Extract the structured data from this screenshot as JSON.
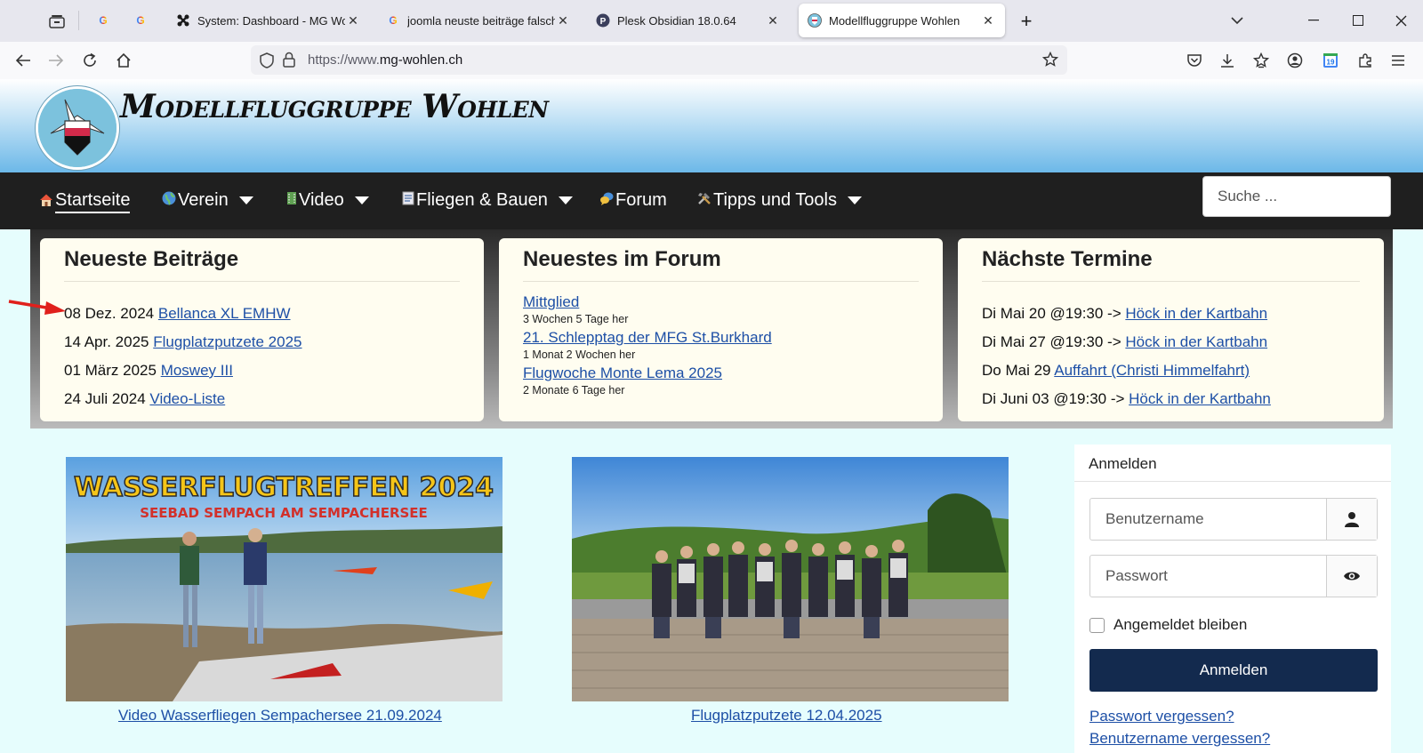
{
  "browser": {
    "tabs": [
      {
        "title": "",
        "favicon": "google-icon"
      },
      {
        "title": "",
        "favicon": "google-icon"
      },
      {
        "title": "System: Dashboard - MG Wohle",
        "favicon": "joomla-icon"
      },
      {
        "title": "joomla neuste beiträge falsches",
        "favicon": "google-icon"
      },
      {
        "title": "Plesk Obsidian 18.0.64",
        "favicon": "plesk-icon"
      },
      {
        "title": "Modellfluggruppe Wohlen",
        "favicon": "site-icon"
      }
    ],
    "url_prefix": "https://www.",
    "url_domain": "mg-wohlen.ch",
    "calendar_badge": "19"
  },
  "site": {
    "title": "Modellfluggruppe Wohlen",
    "menu": [
      {
        "label": "Startseite",
        "icon": "house-icon",
        "active": true
      },
      {
        "label": "Verein",
        "icon": "globe-icon"
      },
      {
        "label": "Video",
        "icon": "film-icon"
      },
      {
        "label": "Fliegen & Bauen",
        "icon": "book-icon"
      },
      {
        "label": "Forum",
        "icon": "chat-icon"
      },
      {
        "label": "Tipps und Tools",
        "icon": "tools-icon"
      }
    ],
    "search_placeholder": "Suche ..."
  },
  "panels": {
    "latest": {
      "title": "Neueste Beiträge",
      "items": [
        {
          "date": "08 Dez. 2024",
          "link": "Bellanca XL EMHW"
        },
        {
          "date": "14 Apr. 2025",
          "link": "Flugplatzputzete 2025"
        },
        {
          "date": "01 März 2025",
          "link": "Moswey III"
        },
        {
          "date": "24 Juli 2024",
          "link": "Video-Liste"
        }
      ]
    },
    "forum": {
      "title": "Neuestes im Forum",
      "items": [
        {
          "link": "Mittglied",
          "age": "3 Wochen 5 Tage her"
        },
        {
          "link": "21. Schlepptag der MFG St.Burkhard",
          "age": "1 Monat 2 Wochen her"
        },
        {
          "link": "Flugwoche Monte Lema 2025",
          "age": "2 Monate 6 Tage her"
        }
      ]
    },
    "events": {
      "title": "Nächste Termine",
      "items": [
        {
          "when": "Di Mai 20 @19:30 -> ",
          "link": "Höck in der Kartbahn"
        },
        {
          "when": "Di Mai 27 @19:30 -> ",
          "link": "Höck in der Kartbahn"
        },
        {
          "when": "Do Mai 29 ",
          "link": "Auffahrt (Christi Himmelfahrt)"
        },
        {
          "when": "Di Juni 03 @19:30 -> ",
          "link": "Höck in der Kartbahn"
        }
      ]
    }
  },
  "content": {
    "photo1": {
      "headline": "WASSERFLUGTREFFEN 2024",
      "subline": "SEEBAD SEMPACH AM SEMPACHERSEE",
      "caption": "Video Wasserfliegen Sempachersee 21.09.2024"
    },
    "photo2": {
      "caption": "Flugplatzputzete 12.04.2025"
    }
  },
  "login": {
    "title": "Anmelden",
    "username_placeholder": "Benutzername",
    "password_placeholder": "Passwort",
    "remember": "Angemeldet bleiben",
    "submit": "Anmelden",
    "forgot_password": "Passwort vergessen?",
    "forgot_username": "Benutzername vergessen?"
  }
}
